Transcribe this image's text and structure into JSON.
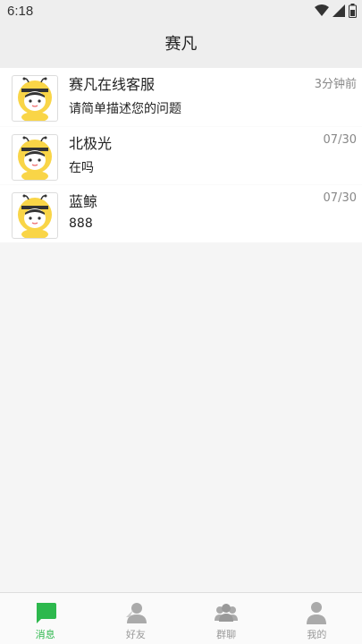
{
  "status_bar": {
    "time": "6:18",
    "icons": [
      "wifi-icon",
      "signal-icon",
      "battery-icon"
    ]
  },
  "header": {
    "title": "赛凡"
  },
  "conversations": [
    {
      "name": "赛凡在线客服",
      "last_message": "请简单描述您的问题",
      "time": "3分钟前"
    },
    {
      "name": "北极光",
      "last_message": "在吗",
      "time": "07/30"
    },
    {
      "name": "蓝鲸",
      "last_message": "888",
      "time": "07/30"
    }
  ],
  "tabs": [
    {
      "label": "消息",
      "icon": "message-icon",
      "active": true
    },
    {
      "label": "好友",
      "icon": "friend-icon",
      "active": false
    },
    {
      "label": "群聊",
      "icon": "group-icon",
      "active": false
    },
    {
      "label": "我的",
      "icon": "profile-icon",
      "active": false
    }
  ],
  "colors": {
    "accent": "#2db84d",
    "inactive": "#999999",
    "header_bg": "#eeeeee"
  }
}
